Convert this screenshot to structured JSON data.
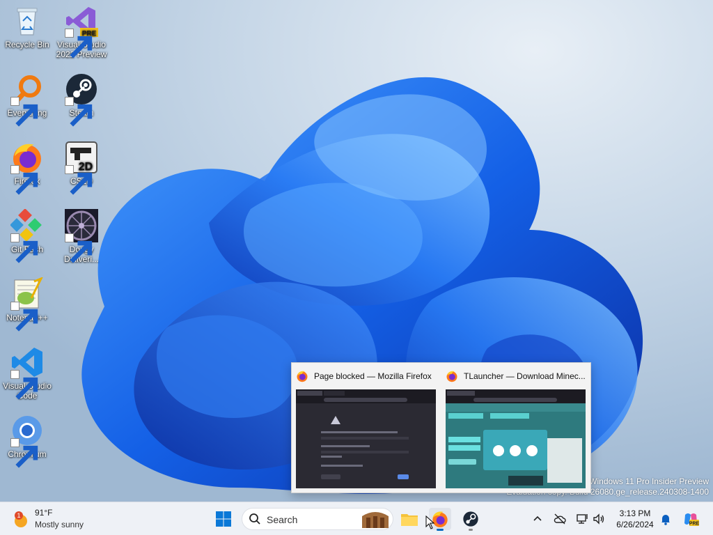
{
  "desktop": {
    "icons": [
      {
        "label": "Recycle Bin",
        "icon": "recycle-bin-icon"
      },
      {
        "label": "Visual Studio 2022 Preview",
        "icon": "visual-studio-icon",
        "badge": "PRE"
      },
      {
        "label": "Everything",
        "icon": "everything-icon"
      },
      {
        "label": "Steam",
        "icon": "steam-icon"
      },
      {
        "label": "Firefox",
        "icon": "firefox-icon"
      },
      {
        "label": "CS2D",
        "icon": "cs2d-icon",
        "badge": "2D"
      },
      {
        "label": "Git Bash",
        "icon": "git-bash-icon"
      },
      {
        "label": "Dodgy Deliveri...",
        "icon": "dodgy-deliveries-icon"
      },
      {
        "label": "Notepad++",
        "icon": "notepad-plus-plus-icon"
      },
      {
        "label": "Visual Studio Code",
        "icon": "vscode-icon"
      },
      {
        "label": "Chromium",
        "icon": "chromium-icon"
      }
    ]
  },
  "watermark": {
    "line1": "Windows 11 Pro Insider Preview",
    "line2": "Evaluation copy. Build 26080.ge_release.240308-1400"
  },
  "preview": {
    "windows": [
      {
        "title": "Page blocked — Mozilla Firefox"
      },
      {
        "title": "TLauncher — Download Minec..."
      }
    ]
  },
  "taskbar": {
    "weather": {
      "temp": "91°F",
      "condition": "Mostly sunny",
      "badge": "1"
    },
    "search_placeholder": "Search",
    "clock": {
      "time": "3:13 PM",
      "date": "6/26/2024"
    }
  },
  "colors": {
    "accent": "#0067c0",
    "bloom_dark": "#0a2aa8",
    "bloom_light": "#3a8cff"
  }
}
